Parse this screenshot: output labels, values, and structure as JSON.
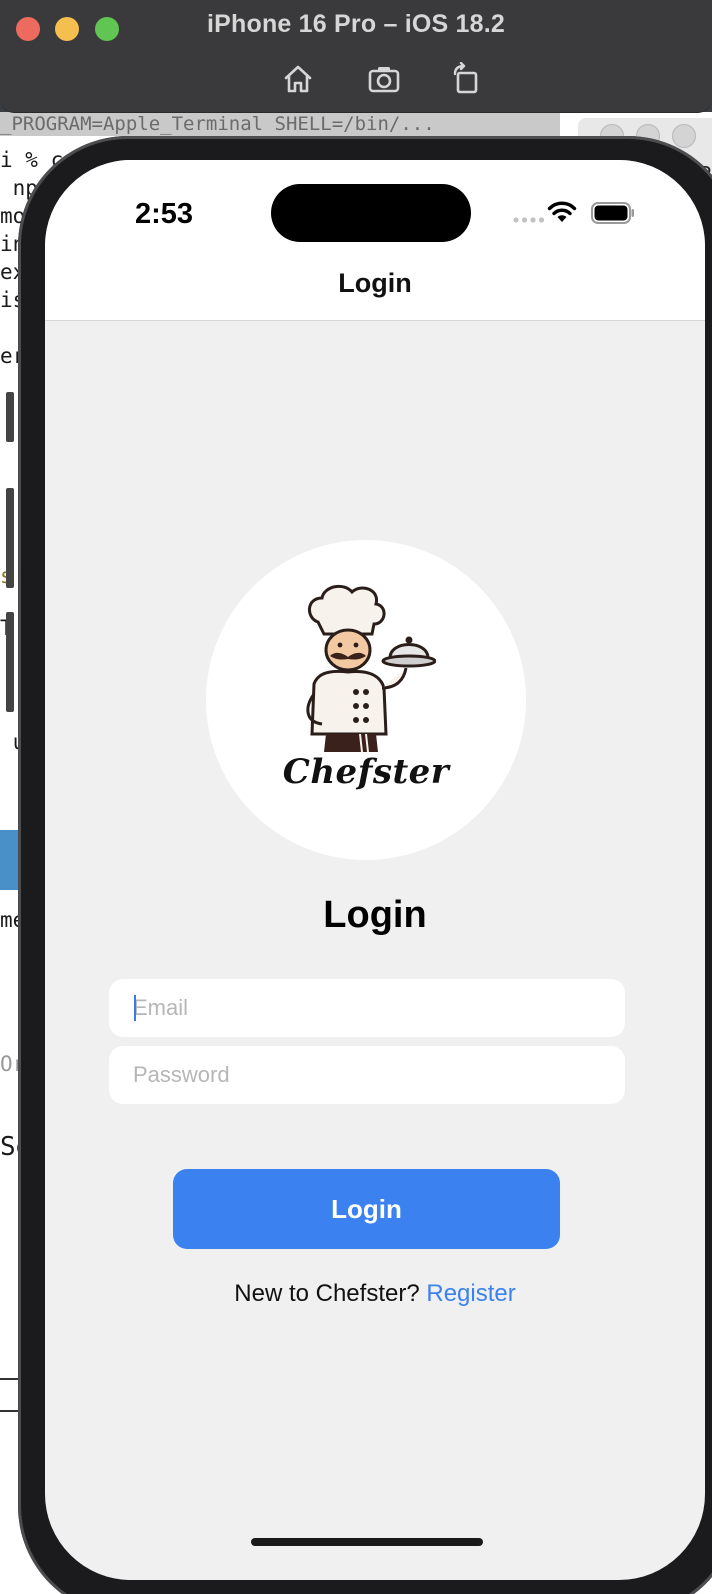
{
  "simulator": {
    "title": "iPhone 16 Pro – iOS 18.2",
    "icons": [
      "home-icon",
      "screenshot-icon",
      "rotate-icon"
    ]
  },
  "background": {
    "terminal_header": "_PROGRAM=Apple_Terminal SHELL=/bin/...",
    "terminal_lines": [
      "i % c",
      " np",
      "mo",
      "in",
      "ex",
      "is",
      "er",
      "s",
      "T",
      " u",
      "me",
      "Or",
      "Se"
    ],
    "right_text": "R"
  },
  "status_bar": {
    "time": "2:53",
    "icons": [
      "signal-icon",
      "wifi-icon",
      "battery-icon"
    ]
  },
  "nav": {
    "title": "Login"
  },
  "logo": {
    "brand": "Chefster",
    "icon": "chef-mascot-icon"
  },
  "form": {
    "heading": "Login",
    "email_placeholder": "Email",
    "email_value": "",
    "password_placeholder": "Password",
    "password_value": "",
    "submit_label": "Login"
  },
  "footer": {
    "prompt": "New to Chefster?",
    "link_label": "Register"
  },
  "colors": {
    "accent": "#3b82f0",
    "screen_bg": "#f0f0f0",
    "card_bg": "#ffffff"
  }
}
